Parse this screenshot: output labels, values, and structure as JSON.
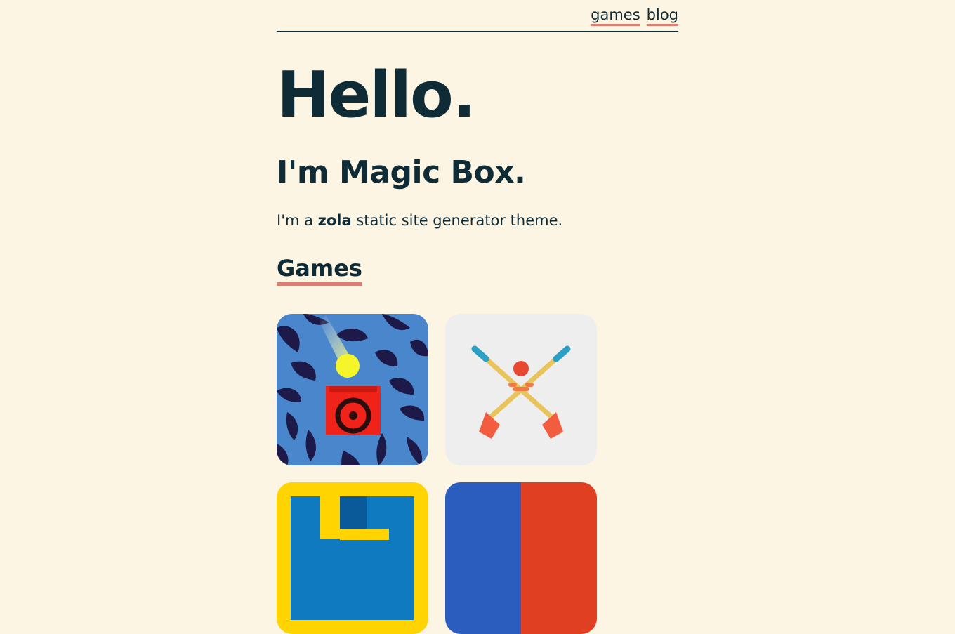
{
  "nav": {
    "links": [
      {
        "label": "games"
      },
      {
        "label": "blog"
      }
    ]
  },
  "hero": {
    "title": "Hello.",
    "subtitle": "I'm Magic Box.",
    "tagline_prefix": "I'm a ",
    "tagline_bold": "zola",
    "tagline_suffix": " static site generator theme."
  },
  "games_section": {
    "title": "Games"
  },
  "colors": {
    "background": "#fdf5e3",
    "text": "#0f2b36",
    "underline_accent": "#e07b6f"
  }
}
